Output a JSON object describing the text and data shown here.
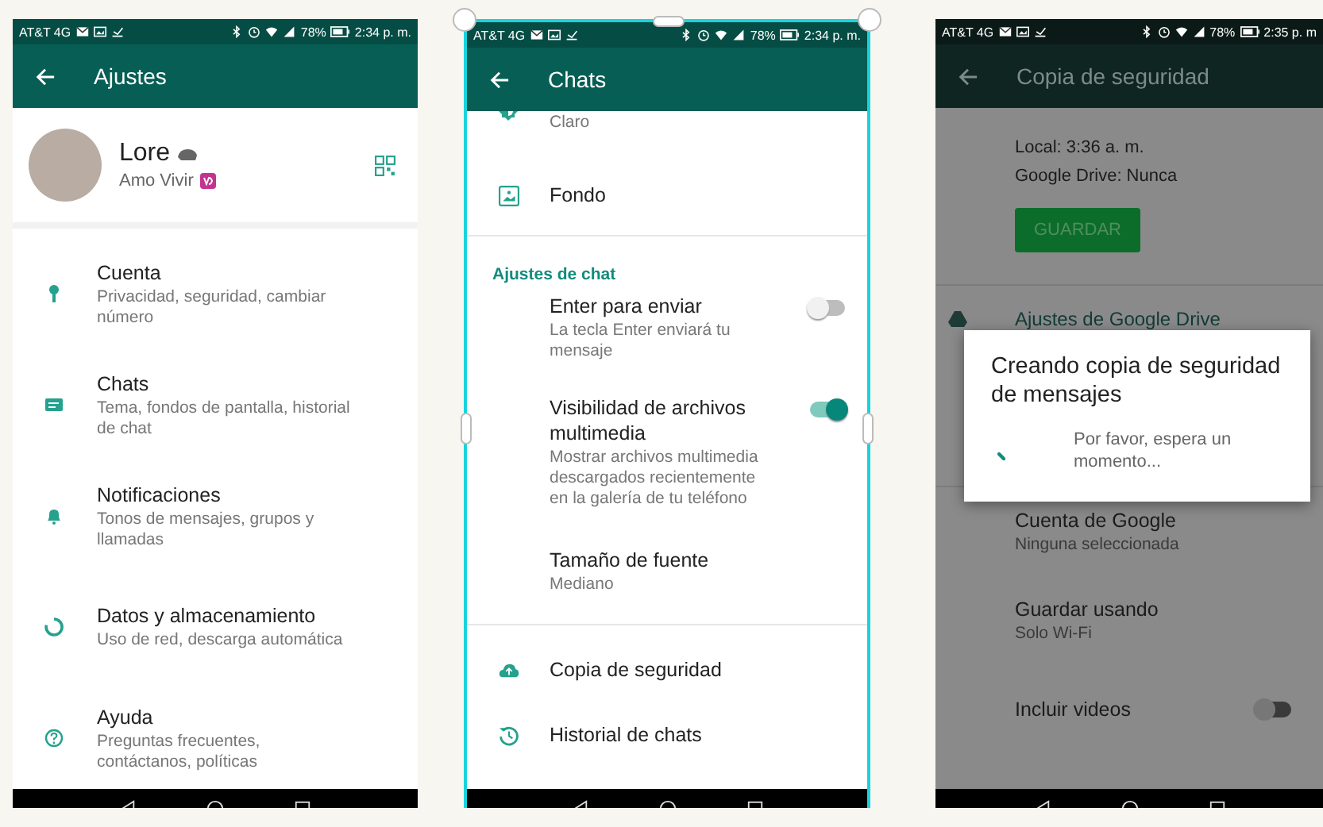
{
  "phones": [
    {
      "kind": "settings",
      "selected": false,
      "dimmed": false,
      "status_bar": {
        "carrier": "AT&T 4G",
        "battery": "78%",
        "time": "2:34 p. m."
      },
      "title": "Ajustes",
      "profile": {
        "name": "Lore",
        "status": "Amo Vivir"
      },
      "items": [
        {
          "title": "Cuenta",
          "subtitle": "Privacidad, seguridad, cambiar número"
        },
        {
          "title": "Chats",
          "subtitle": "Tema, fondos de pantalla, historial de chat"
        },
        {
          "title": "Notificaciones",
          "subtitle": "Tonos de mensajes, grupos y llamadas"
        },
        {
          "title": "Datos y almacenamiento",
          "subtitle": "Uso de red, descarga automática"
        },
        {
          "title": "Ayuda",
          "subtitle": "Preguntas frecuentes, contáctanos, políticas"
        }
      ]
    },
    {
      "kind": "chat_settings",
      "selected": true,
      "dimmed": false,
      "status_bar": {
        "carrier": "AT&T 4G",
        "battery": "78%",
        "time": "2:34 p. m."
      },
      "title": "Chats",
      "sections": [
        {
          "rows": [
            {
              "kind": "row",
              "subtitle": "Claro"
            },
            {
              "kind": "row",
              "title": "Fondo"
            }
          ]
        },
        {
          "header": "Ajustes de chat",
          "rows": [
            {
              "kind": "toggle",
              "title": "Enter para enviar",
              "subtitle": "La tecla Enter enviará tu mensaje",
              "on": false
            },
            {
              "kind": "toggle",
              "title": "Visibilidad de archivos multimedia",
              "subtitle": "Mostrar archivos multimedia descargados recientemente en la galería de tu teléfono",
              "on": true
            },
            {
              "kind": "row",
              "title": "Tamaño de fuente",
              "subtitle": "Mediano"
            }
          ]
        },
        {
          "rows": [
            {
              "kind": "row",
              "title": "Copia de seguridad"
            },
            {
              "kind": "row",
              "title": "Historial de chats"
            }
          ]
        }
      ]
    },
    {
      "kind": "backup",
      "selected": false,
      "dimmed": true,
      "status_bar": {
        "carrier": "AT&T 4G",
        "battery": "78%",
        "time": "2:35 p. m"
      },
      "title": "Copia de seguridad",
      "info": [
        "Local: 3:36 a. m.",
        "Google Drive: Nunca"
      ],
      "button": "GUARDAR",
      "drive_header": "Ajustes de Google Drive",
      "rows": [
        {
          "kind": "row",
          "title": "Cuenta de Google",
          "subtitle": "Ninguna seleccionada"
        },
        {
          "kind": "row",
          "title": "Guardar usando",
          "subtitle": "Solo Wi-Fi"
        },
        {
          "kind": "toggle",
          "title": "Incluir videos",
          "on": false
        }
      ],
      "dialog": {
        "title": "Creando copia de seguridad de mensajes",
        "message": "Por favor, espera un momento..."
      }
    }
  ]
}
